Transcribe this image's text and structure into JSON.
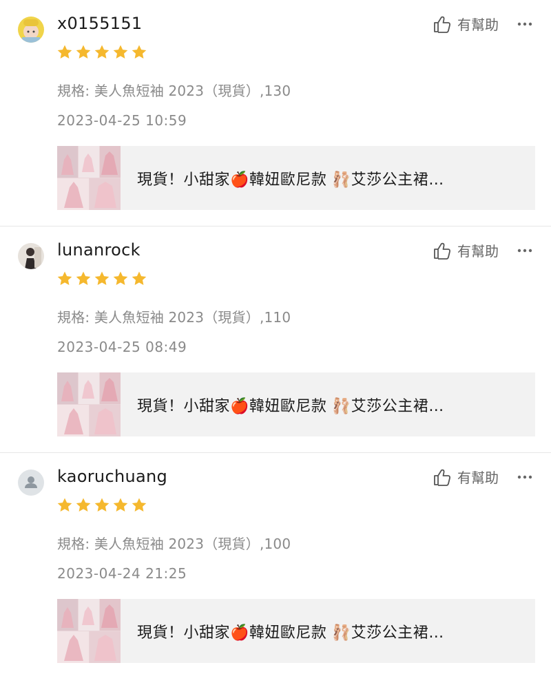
{
  "reviews": [
    {
      "username": "x0155151",
      "helpful_label": "有幫助",
      "rating": 5,
      "spec": "規格: 美人魚短袖 2023（現貨）,130",
      "date": "2023-04-25 10:59",
      "product_title": "現貨！小甜家🍎韓妞歐尼款 🩰艾莎公主裙…",
      "avatar_icon": "photo-avatar-icon"
    },
    {
      "username": "lunanrock",
      "helpful_label": "有幫助",
      "rating": 5,
      "spec": "規格: 美人魚短袖 2023（現貨）,110",
      "date": "2023-04-25 08:49",
      "product_title": "現貨！小甜家🍎韓妞歐尼款 🩰艾莎公主裙…",
      "avatar_icon": "photo-avatar-icon"
    },
    {
      "username": "kaoruchuang",
      "helpful_label": "有幫助",
      "rating": 5,
      "spec": "規格: 美人魚短袖 2023（現貨）,100",
      "date": "2023-04-24 21:25",
      "product_title": "現貨！小甜家🍎韓妞歐尼款 🩰艾莎公主裙…",
      "avatar_icon": "default-user-avatar-icon"
    }
  ],
  "colors": {
    "star": "#f5b82e",
    "secondary_text": "#8a8a8a",
    "product_bg": "#f2f2f2",
    "divider": "#e6e6e6"
  }
}
